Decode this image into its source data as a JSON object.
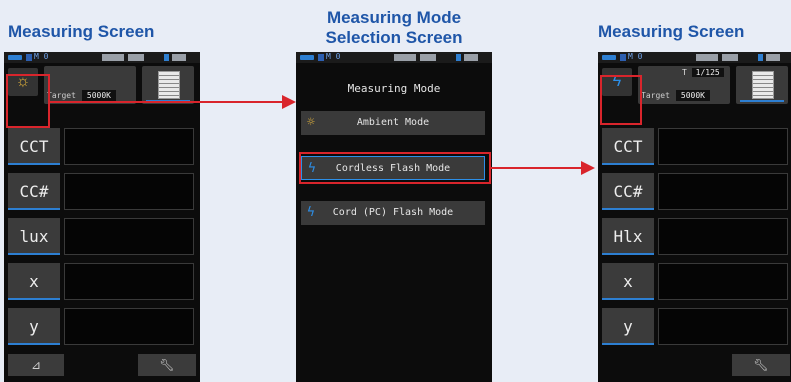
{
  "captions": {
    "left": "Measuring Screen",
    "middle_line1": "Measuring Mode",
    "middle_line2": "Selection Screen",
    "right": "Measuring Screen"
  },
  "statusbar": {
    "memory": "M 0"
  },
  "left_screen": {
    "mode_icon": "ambient-sun-icon",
    "target_label": "Target",
    "target_value": "5000K",
    "rows": [
      "CCT",
      "CC#",
      "lux",
      "x",
      "y"
    ],
    "bottom_left_icon": "delta-icon",
    "bottom_right_icon": "wrench-icon"
  },
  "mode_screen": {
    "title": "Measuring Mode",
    "items": [
      {
        "label": "Ambient Mode",
        "icon": "ambient-sun-icon"
      },
      {
        "label": "Cordless Flash Mode",
        "icon": "flash-icon",
        "selected": true
      },
      {
        "label": "Cord (PC) Flash Mode",
        "icon": "cord-flash-icon"
      }
    ]
  },
  "right_screen": {
    "mode_icon": "flash-icon",
    "shutter_label": "T",
    "shutter_value": "1/125",
    "target_label": "Target",
    "target_value": "5000K",
    "rows": [
      "CCT",
      "CC#",
      "Hlx",
      "x",
      "y"
    ],
    "bottom_right_icon": "wrench-icon"
  },
  "colors": {
    "caption": "#1f56a8",
    "highlight": "#d9252c",
    "accent": "#2d8fe8"
  }
}
